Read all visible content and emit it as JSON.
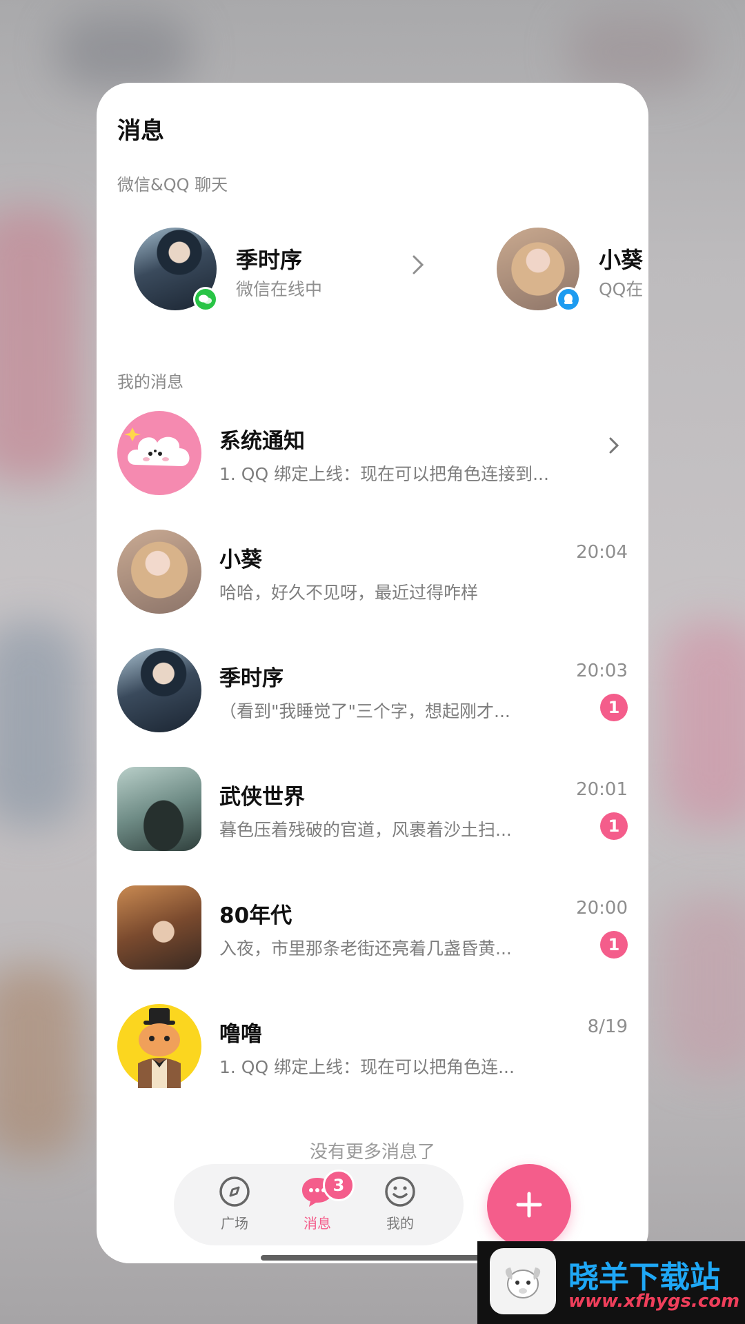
{
  "header": {
    "title": "消息"
  },
  "sections": {
    "linked_chats": "微信&QQ 聊天",
    "my_messages": "我的消息"
  },
  "linked_chats": [
    {
      "name": "季时序",
      "status": "微信在线中",
      "platform": "wechat"
    },
    {
      "name": "小葵",
      "status": "QQ在",
      "platform": "qq"
    }
  ],
  "messages": [
    {
      "name": "系统通知",
      "preview": "1. QQ 绑定上线：现在可以把角色连接到...",
      "time": "",
      "unread": ""
    },
    {
      "name": "小葵",
      "preview": "哈哈，好久不见呀，最近过得咋样",
      "time": "20:04",
      "unread": ""
    },
    {
      "name": "季时序",
      "preview": "（看到\"我睡觉了\"三个字，想起刚才...",
      "time": "20:03",
      "unread": "1"
    },
    {
      "name": "武侠世界",
      "preview": "暮色压着残破的官道，风裹着沙土扫...",
      "time": "20:01",
      "unread": "1"
    },
    {
      "name": "80年代",
      "preview": "入夜，市里那条老街还亮着几盏昏黄...",
      "time": "20:00",
      "unread": "1"
    },
    {
      "name": "噜噜",
      "preview": "1. QQ 绑定上线：现在可以把角色连...",
      "time": "8/19",
      "unread": ""
    }
  ],
  "footer": {
    "no_more": "没有更多消息了"
  },
  "nav": {
    "items": [
      {
        "label": "广场",
        "icon": "compass-icon"
      },
      {
        "label": "消息",
        "icon": "chat-bubble-icon",
        "badge": "3"
      },
      {
        "label": "我的",
        "icon": "smiley-icon"
      }
    ],
    "fab_icon": "plus-icon"
  },
  "watermark": {
    "title": "晓羊下载站",
    "url": "www.xfhygs.com"
  },
  "colors": {
    "accent": "#f45d8b",
    "wechat": "#28c445",
    "qq": "#1d9bf0"
  }
}
